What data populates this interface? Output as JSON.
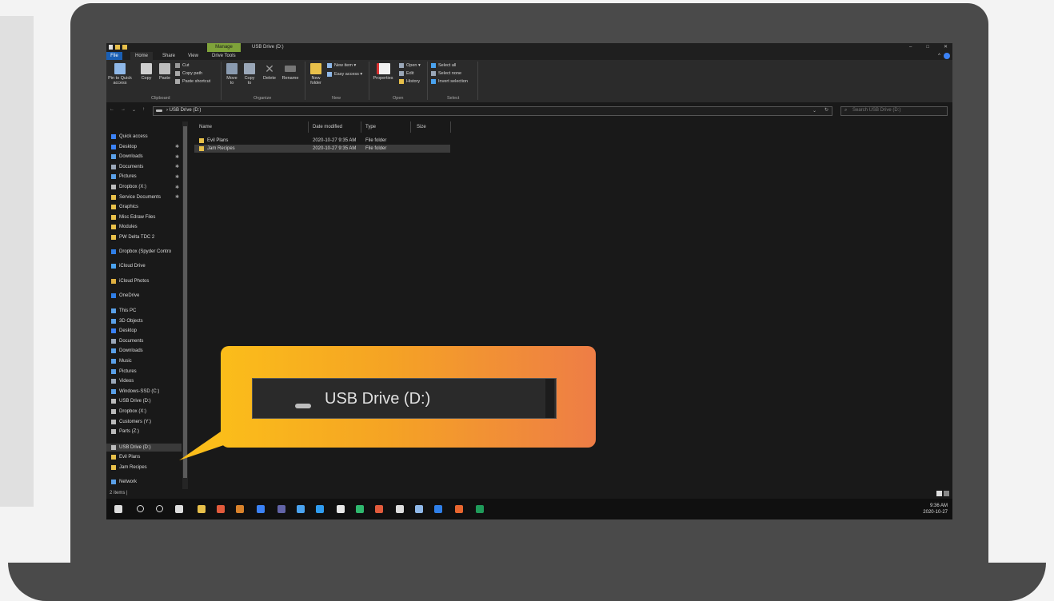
{
  "window": {
    "manage_tab": "Manage",
    "title": "USB Drive (D:)",
    "controls": [
      "–",
      "□",
      "✕"
    ]
  },
  "menu": {
    "tabs": [
      "File",
      "Home",
      "Share",
      "View",
      "Drive Tools"
    ]
  },
  "ribbon": {
    "clipboard": {
      "pin": "Pin to Quick access",
      "copy": "Copy",
      "paste": "Paste",
      "cut": "Cut",
      "copy_path": "Copy path",
      "paste_shortcut": "Paste shortcut",
      "label": "Clipboard"
    },
    "organize": {
      "move_to": "Move to",
      "copy_to": "Copy to",
      "delete": "Delete",
      "rename": "Rename",
      "label": "Organize"
    },
    "new": {
      "new_folder": "New folder",
      "new_item": "New item ▾",
      "easy_access": "Easy access ▾",
      "label": "New"
    },
    "open": {
      "properties": "Properties",
      "open": "Open ▾",
      "edit": "Edit",
      "history": "History",
      "label": "Open"
    },
    "select": {
      "select_all": "Select all",
      "select_none": "Select none",
      "invert": "Invert selection",
      "label": "Select"
    }
  },
  "address": {
    "nav": [
      "←",
      "→",
      "⌄",
      "↑"
    ],
    "path": "›  USB Drive (D:)",
    "search_placeholder": "Search USB Drive (D:)"
  },
  "nav_pane": {
    "items": [
      {
        "label": "Quick access",
        "color": "#3b82f6"
      },
      {
        "label": "Desktop",
        "color": "#3b82f6",
        "pinned": true
      },
      {
        "label": "Downloads",
        "color": "#5aa0e8",
        "pinned": true
      },
      {
        "label": "Documents",
        "color": "#9aa7b8",
        "pinned": true
      },
      {
        "label": "Pictures",
        "color": "#5aa0e8",
        "pinned": true
      },
      {
        "label": "Dropbox (X:)",
        "color": "#bbbbbb",
        "pinned": true
      },
      {
        "label": "Service Documents",
        "color": "#e8c04a",
        "pinned": true
      },
      {
        "label": "Graphics",
        "color": "#e8c04a"
      },
      {
        "label": "Misc Edraw Files",
        "color": "#e8c04a"
      },
      {
        "label": "Modules",
        "color": "#e8c04a"
      },
      {
        "label": "PW Delta TDC 2",
        "color": "#e8c04a"
      },
      {
        "label": "Dropbox (Spyder Contro",
        "color": "#2f7fe8"
      },
      {
        "label": "iCloud Drive",
        "color": "#4aa3f0"
      },
      {
        "label": "iCloud Photos",
        "color": "#e0b040"
      },
      {
        "label": "OneDrive",
        "color": "#2f7fe8"
      },
      {
        "label": "This PC",
        "color": "#5aa0e8"
      },
      {
        "label": "3D Objects",
        "color": "#5aa0e8"
      },
      {
        "label": "Desktop",
        "color": "#3b82f6"
      },
      {
        "label": "Documents",
        "color": "#9aa7b8"
      },
      {
        "label": "Downloads",
        "color": "#5aa0e8"
      },
      {
        "label": "Music",
        "color": "#5aa0e8"
      },
      {
        "label": "Pictures",
        "color": "#5aa0e8"
      },
      {
        "label": "Videos",
        "color": "#9aa7b8"
      },
      {
        "label": "Windows-SSD (C:)",
        "color": "#5aa0e8"
      },
      {
        "label": "USB Drive (D:)",
        "color": "#bbbbbb"
      },
      {
        "label": "Dropbox (X:)",
        "color": "#bbbbbb"
      },
      {
        "label": "Customers (Y:)",
        "color": "#bbbbbb"
      },
      {
        "label": "Parts (Z:)",
        "color": "#bbbbbb"
      },
      {
        "label": "USB Drive (D:)",
        "color": "#bbbbbb",
        "selected": true
      },
      {
        "label": "Evil Plans",
        "color": "#e8c04a"
      },
      {
        "label": "Jam Recipes",
        "color": "#e8c04a"
      },
      {
        "label": "Network",
        "color": "#5aa0e8"
      }
    ]
  },
  "files": {
    "columns": [
      "Name",
      "Date modified",
      "Type",
      "Size"
    ],
    "rows": [
      {
        "name": "Evil Plans",
        "date": "2020-10-27 9:35 AM",
        "type": "File folder",
        "size": ""
      },
      {
        "name": "Jam Recipes",
        "date": "2020-10-27 9:35 AM",
        "type": "File folder",
        "size": "",
        "selected": true
      }
    ]
  },
  "status": {
    "count": "2 items  |"
  },
  "taskbar": {
    "icons": [
      {
        "name": "start-icon",
        "color": "#dddddd"
      },
      {
        "name": "search-icon",
        "color": "#dddddd"
      },
      {
        "name": "cortana-icon",
        "color": "#dddddd"
      },
      {
        "name": "task-view-icon",
        "color": "#dddddd"
      },
      {
        "name": "file-explorer-icon",
        "color": "#e8c04a"
      },
      {
        "name": "chrome-icon",
        "color": "#e25b3c"
      },
      {
        "name": "app-orange-icon",
        "color": "#d9822b"
      },
      {
        "name": "app-blue-icon",
        "color": "#3b82f6"
      },
      {
        "name": "teams-icon",
        "color": "#6264a7"
      },
      {
        "name": "app-screen-icon",
        "color": "#4aa3f0"
      },
      {
        "name": "app-d-icon",
        "color": "#2f9cf0"
      },
      {
        "name": "notepad-icon",
        "color": "#e8e8e8"
      },
      {
        "name": "app-green-icon",
        "color": "#2fb86e"
      },
      {
        "name": "chrome-alt-icon",
        "color": "#e25b3c"
      },
      {
        "name": "settings-icon",
        "color": "#dddddd"
      },
      {
        "name": "app-pen-icon",
        "color": "#8fb8e8"
      },
      {
        "name": "outlook-icon",
        "color": "#2f7fe8"
      },
      {
        "name": "app-q-icon",
        "color": "#e8662f"
      },
      {
        "name": "excel-icon",
        "color": "#1f9b5a"
      }
    ],
    "time": "9:36 AM",
    "date": "2020-10-27"
  },
  "callout": {
    "label": "USB Drive (D:)"
  },
  "colors": {
    "accent": "#1a5fb4",
    "manage": "#7fa33a",
    "callout_start": "#fbbd1a",
    "callout_end": "#ee7d46"
  }
}
